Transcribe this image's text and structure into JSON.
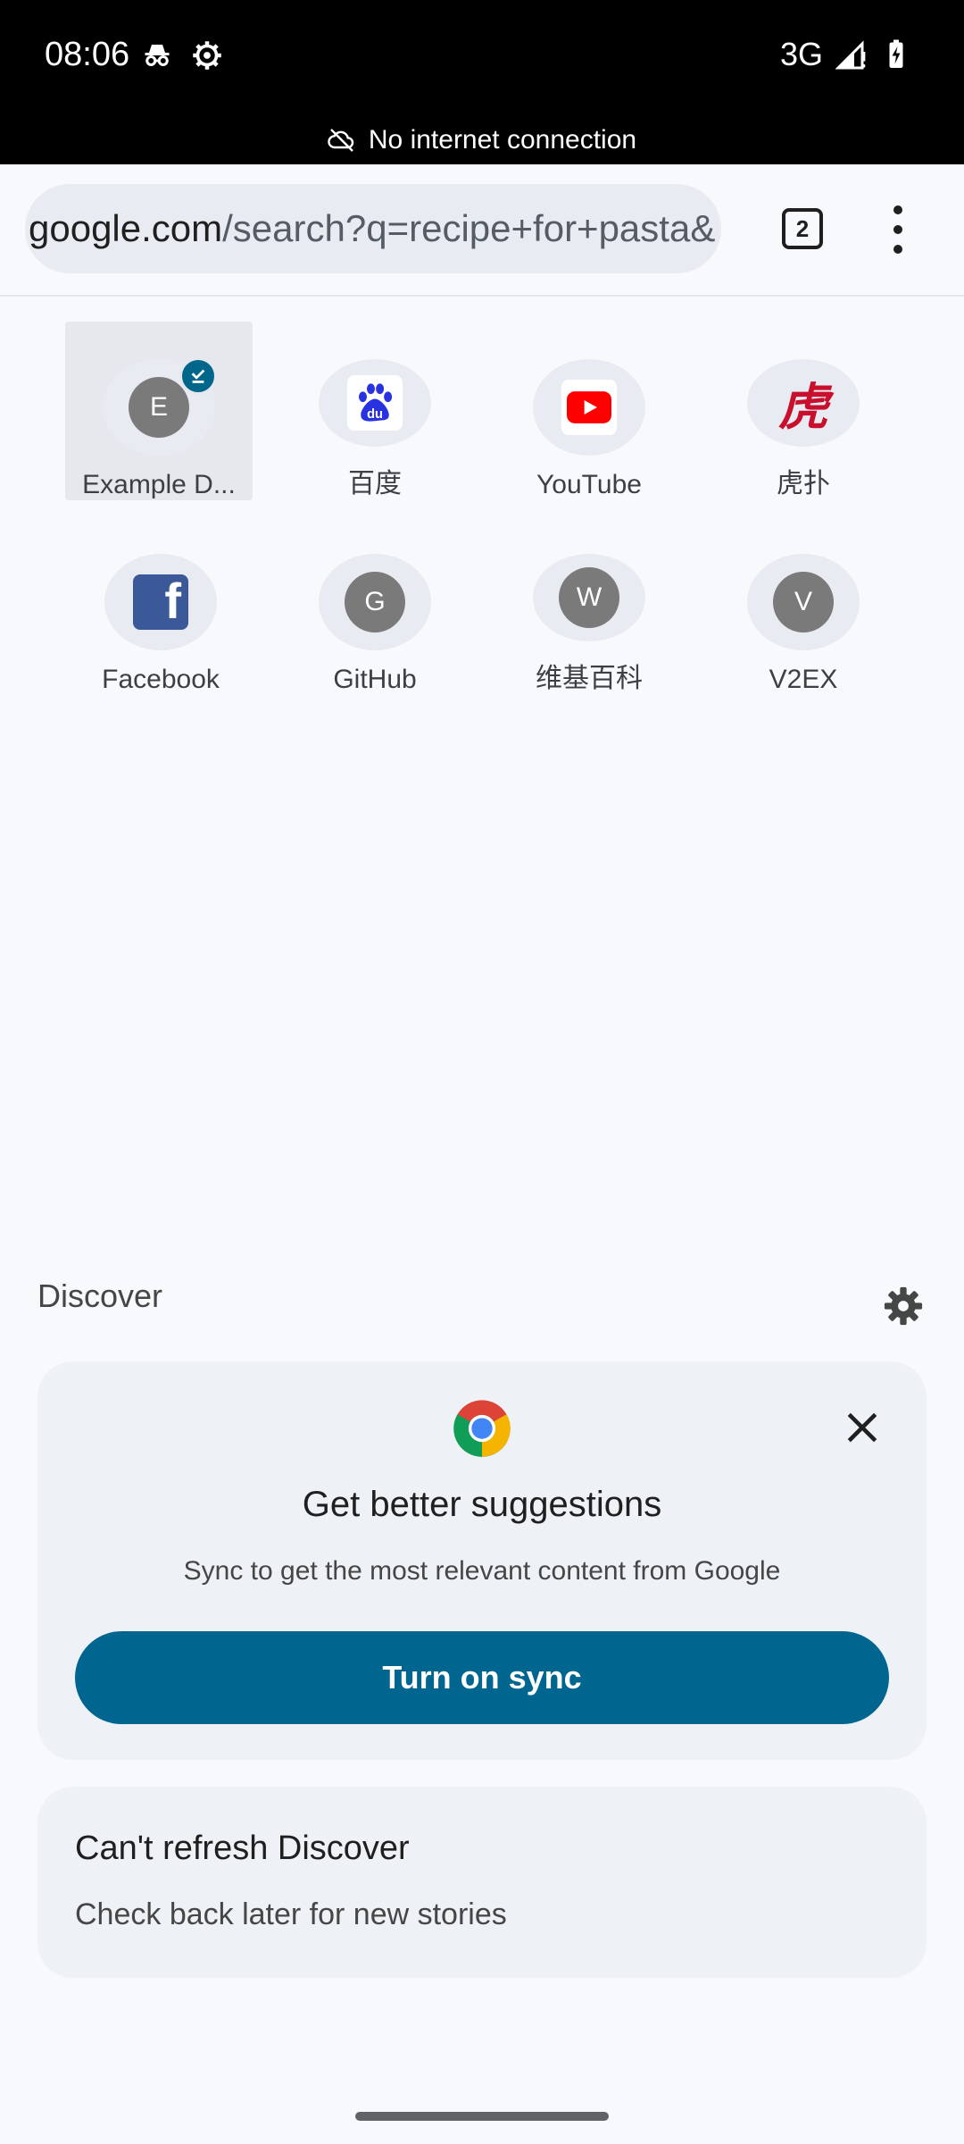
{
  "status_bar": {
    "time": "08:06",
    "network": "3G",
    "icons": [
      "incognito-icon",
      "settings-gear-icon",
      "signal-icon",
      "battery-charging-icon"
    ]
  },
  "offline_banner": {
    "text": "No internet connection",
    "icon": "cloud-off-icon"
  },
  "toolbar": {
    "url_host": "google.com",
    "url_path": "/search?q=recipe+for+pasta&",
    "tab_count": "2",
    "menu_icon": "more-vert-icon"
  },
  "shortcuts": [
    {
      "label": "Example D...",
      "letter": "E",
      "kind": "letter",
      "selected": true
    },
    {
      "label": "百度",
      "kind": "baidu"
    },
    {
      "label": "YouTube",
      "kind": "youtube"
    },
    {
      "label": "虎扑",
      "kind": "hupu",
      "glyph": "虎"
    },
    {
      "label": "Facebook",
      "kind": "facebook",
      "glyph": "f"
    },
    {
      "label": "GitHub",
      "letter": "G",
      "kind": "letter"
    },
    {
      "label": "维基百科",
      "letter": "W",
      "kind": "letter"
    },
    {
      "label": "V2EX",
      "letter": "V",
      "kind": "letter"
    }
  ],
  "discover": {
    "title": "Discover",
    "settings_icon": "gear-icon"
  },
  "sync_card": {
    "title": "Get better suggestions",
    "description": "Sync to get the most relevant content from Google",
    "button": "Turn on sync",
    "close_icon": "close-icon"
  },
  "refresh_card": {
    "title": "Can't refresh Discover",
    "description": "Check back later for new stories"
  },
  "colors": {
    "accent": "#00658f",
    "badge": "#00668a",
    "youtube_red": "#ff0000",
    "hupu_red": "#c8102e",
    "facebook_blue": "#3b5998",
    "baidu_blue": "#2932e1"
  }
}
